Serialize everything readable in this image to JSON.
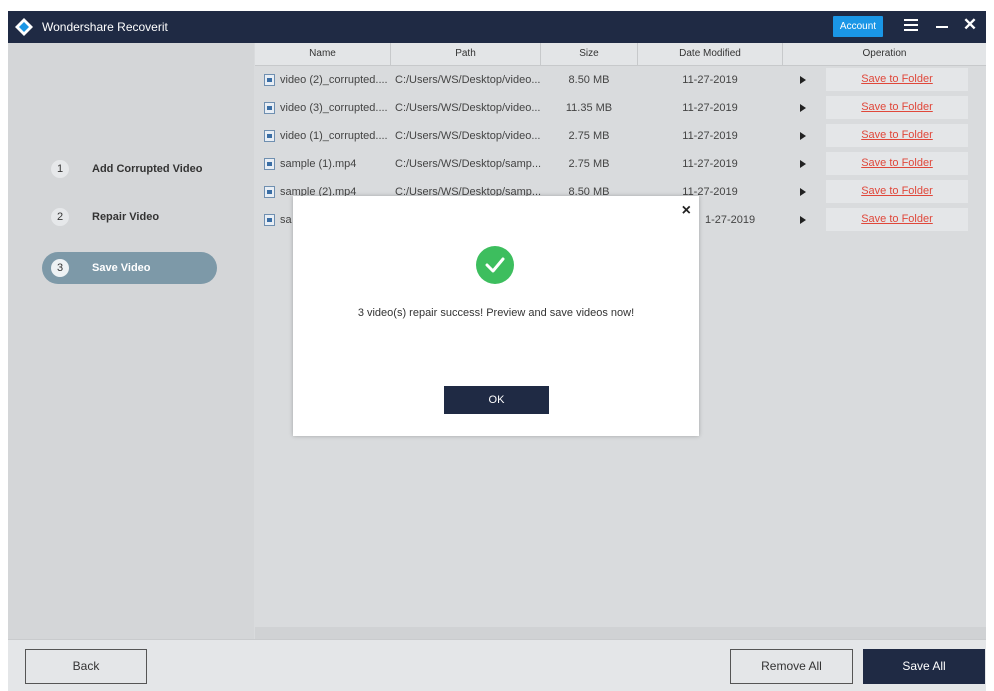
{
  "window": {
    "title": "Wondershare Recoverit",
    "account_label": "Account",
    "icons": [
      "menu-icon",
      "minimize-icon",
      "close-icon"
    ]
  },
  "steps": [
    {
      "number": "1",
      "label": "Add Corrupted Video",
      "active": false
    },
    {
      "number": "2",
      "label": "Repair Video",
      "active": false
    },
    {
      "number": "3",
      "label": "Save Video",
      "active": true
    }
  ],
  "table": {
    "columns": [
      "Name",
      "Path",
      "Size",
      "Date Modified",
      "Operation"
    ],
    "rows": [
      {
        "name": "video (2)_corrupted....",
        "path": "C:/Users/WS/Desktop/video...",
        "size": "8.50 MB",
        "date": "11-27-2019",
        "action": "Save to Folder"
      },
      {
        "name": "video (3)_corrupted....",
        "path": "C:/Users/WS/Desktop/video...",
        "size": "11.35 MB",
        "date": "11-27-2019",
        "action": "Save to Folder"
      },
      {
        "name": "video (1)_corrupted....",
        "path": "C:/Users/WS/Desktop/video...",
        "size": "2.75 MB",
        "date": "11-27-2019",
        "action": "Save to Folder"
      },
      {
        "name": "sample (1).mp4",
        "path": "C:/Users/WS/Desktop/samp...",
        "size": "2.75 MB",
        "date": "11-27-2019",
        "action": "Save to Folder"
      },
      {
        "name": "sample (2).mp4",
        "path": "C:/Users/WS/Desktop/samp...",
        "size": "8.50 MB",
        "date": "11-27-2019",
        "action": "Save to Folder"
      },
      {
        "name": "sa",
        "path": "",
        "size": "",
        "date": "1-27-2019",
        "action": "Save to Folder"
      }
    ]
  },
  "footer": {
    "back_label": "Back",
    "remove_all_label": "Remove All",
    "save_all_label": "Save All"
  },
  "dialog": {
    "message": "3 video(s) repair success! Preview and save videos now!",
    "ok_label": "OK",
    "close_glyph": "×",
    "status_icon": "check-circle-icon"
  },
  "colors": {
    "titlebar": "#1f2a44",
    "account": "#1a96e6",
    "active_step": "#7d99a8",
    "link": "#e0473a",
    "success": "#3dbe5e"
  }
}
